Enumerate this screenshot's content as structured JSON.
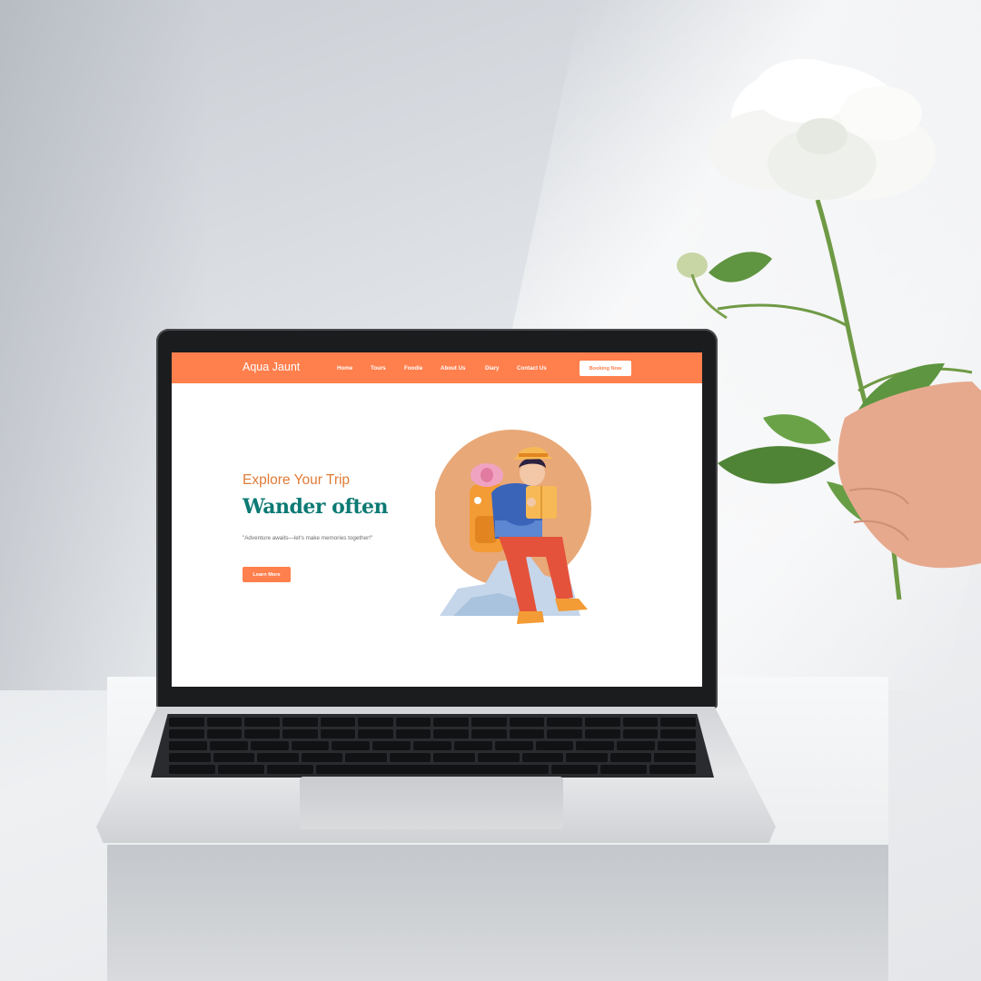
{
  "site": {
    "brand": "Aqua Jaunt",
    "nav": [
      {
        "label": "Home"
      },
      {
        "label": "Tours"
      },
      {
        "label": "Foodie"
      },
      {
        "label": "About Us"
      },
      {
        "label": "Diary"
      },
      {
        "label": "Contact Us"
      }
    ],
    "booking_button": "Booking Now"
  },
  "hero": {
    "subtitle": "Explore Your Trip",
    "title": "Wander often",
    "quote": "\"Adventure awaits—let's make memories together!\"",
    "cta": "Learn More"
  },
  "colors": {
    "accent": "#ff7f4d",
    "title_teal": "#0d7a74",
    "subtitle_orange": "#e07b35",
    "illustration_circle": "#e8a878"
  },
  "icons": {
    "illustration": "hiker-reading-map-illustration",
    "decor": "white-peony-flower"
  }
}
